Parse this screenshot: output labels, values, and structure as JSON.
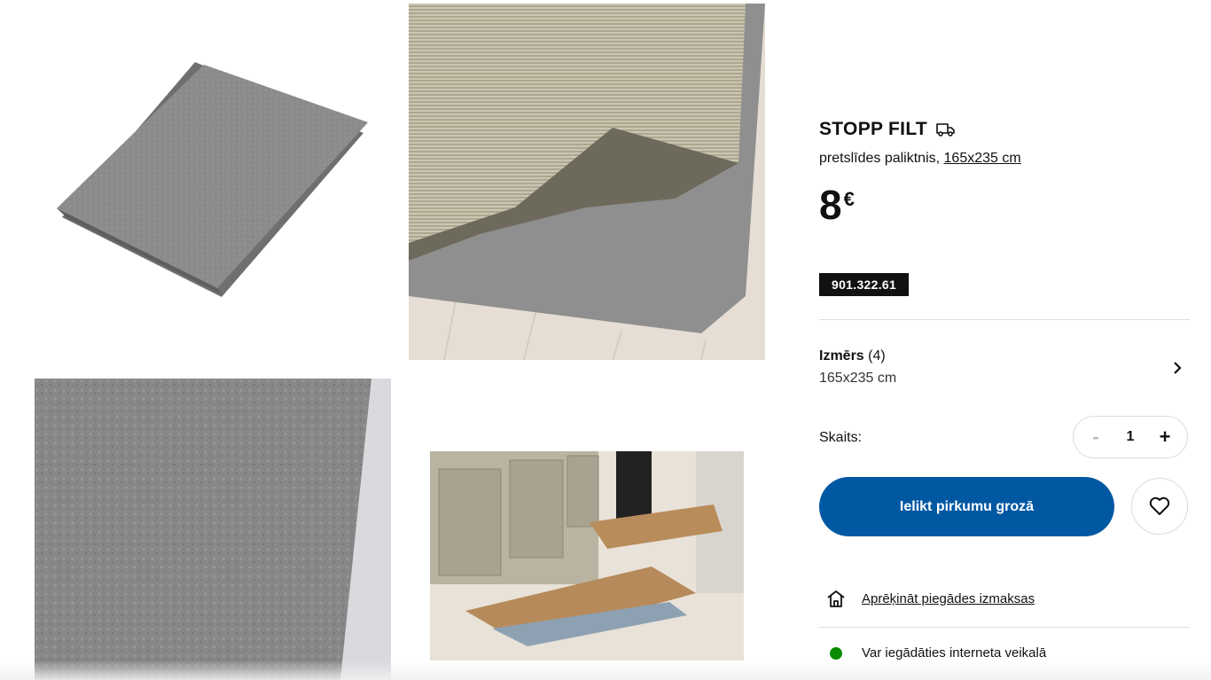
{
  "product": {
    "name": "STOPP FILT",
    "description": "pretslīdes paliktnis, ",
    "size_link": "165x235 cm",
    "price": "8",
    "currency": "€",
    "article_number": "901.322.61"
  },
  "size_selector": {
    "label": "Izmērs",
    "count": " (4)",
    "value": "165x235 cm"
  },
  "quantity": {
    "label": "Skaits:",
    "value": "1",
    "minus": "-",
    "plus": "+"
  },
  "actions": {
    "add_to_cart": "Ielikt pirkumu grozā"
  },
  "delivery": {
    "link": "Aprēķināt piegādes izmaksas"
  },
  "availability": {
    "text": "Var iegādāties interneta veikalā",
    "status_color": "#0a8a00"
  },
  "colors": {
    "primary": "#0058a3",
    "felt": "#8c8c8c"
  }
}
